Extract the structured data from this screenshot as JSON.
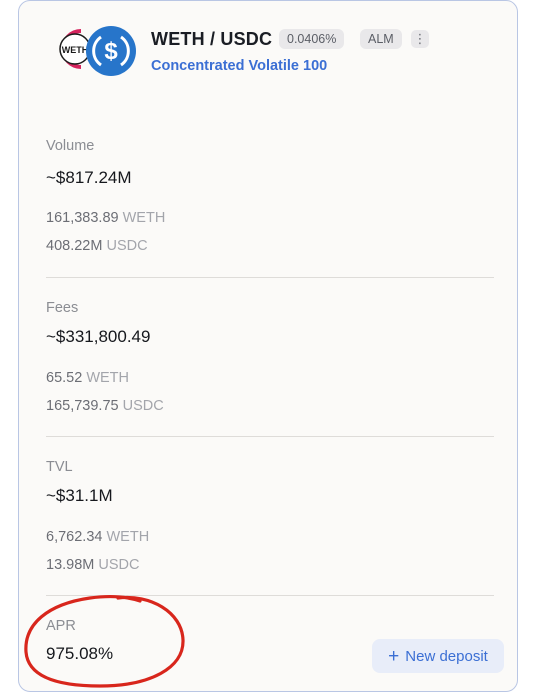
{
  "header": {
    "token_a_logo_text": "WETH",
    "token_b_icon": "usdc-dollar-icon",
    "pair": "WETH / USDC",
    "fee_tier": "0.0406%",
    "tag": "ALM",
    "more": "⋮",
    "strategy": "Concentrated Volatile 100"
  },
  "volume": {
    "label": "Volume",
    "value": "~$817.24M",
    "token_a_amount": "161,383.89",
    "token_a_unit": "WETH",
    "token_b_amount": "408.22M",
    "token_b_unit": "USDC"
  },
  "fees": {
    "label": "Fees",
    "value": "~$331,800.49",
    "token_a_amount": "65.52",
    "token_a_unit": "WETH",
    "token_b_amount": "165,739.75",
    "token_b_unit": "USDC"
  },
  "tvl": {
    "label": "TVL",
    "value": "~$31.1M",
    "token_a_amount": "6,762.34",
    "token_a_unit": "WETH",
    "token_b_amount": "13.98M",
    "token_b_unit": "USDC"
  },
  "apr": {
    "label": "APR",
    "value": "975.08%"
  },
  "actions": {
    "new_deposit": "New deposit"
  },
  "colors": {
    "accent": "#3b6fd4",
    "usdc_blue": "#2775ca",
    "annotation_red": "#d8261c"
  }
}
